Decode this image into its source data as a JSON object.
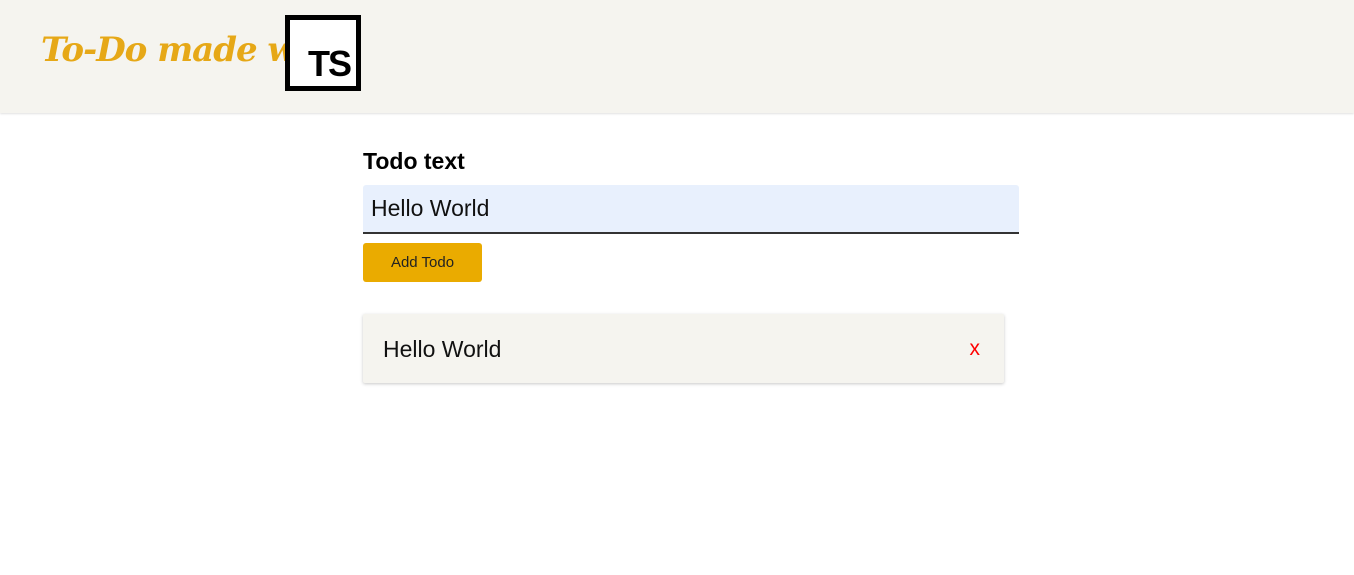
{
  "header": {
    "brand_text": "To-Do made with",
    "logo_text": "TS",
    "brand_color": "#e6a817",
    "background": "#f5f4ef"
  },
  "form": {
    "label": "Todo text",
    "input_value": "Hello World",
    "input_background": "#e8f0fd",
    "submit_label": "Add Todo",
    "submit_color": "#eaab00"
  },
  "todos": [
    {
      "text": "Hello World",
      "delete_label": "x",
      "delete_color": "#ff0000"
    }
  ]
}
